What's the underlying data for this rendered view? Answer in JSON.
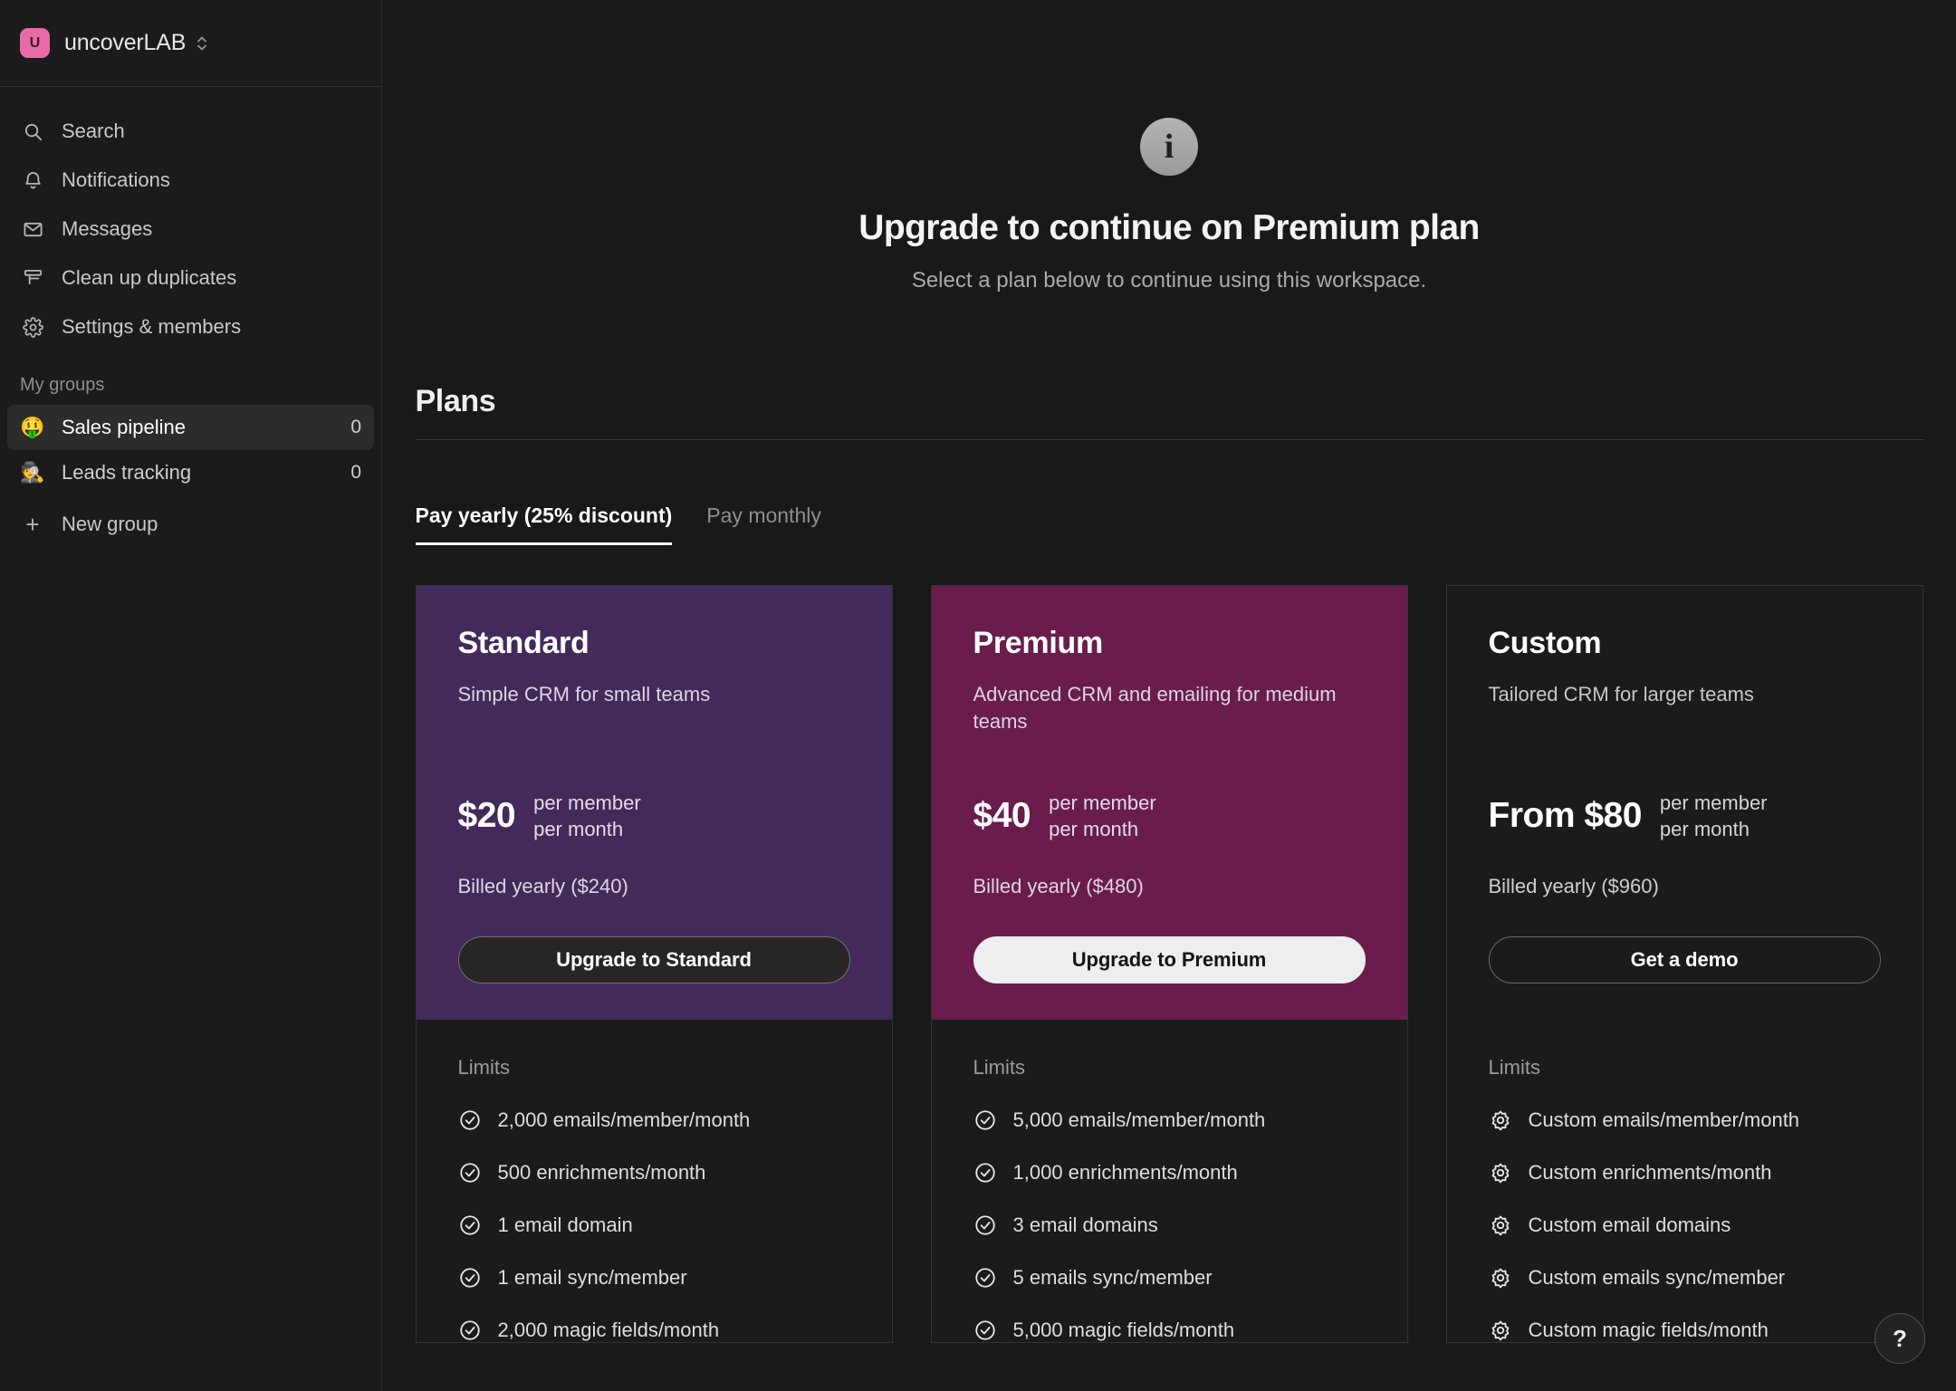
{
  "sidebar": {
    "workspace": {
      "initial": "U",
      "name": "uncoverLAB",
      "logo_color": "#e86aa6"
    },
    "nav": [
      {
        "icon": "search-icon",
        "label": "Search"
      },
      {
        "icon": "bell-icon",
        "label": "Notifications"
      },
      {
        "icon": "envelope-icon",
        "label": "Messages"
      },
      {
        "icon": "merge-icon",
        "label": "Clean up duplicates"
      },
      {
        "icon": "gear-icon",
        "label": "Settings & members"
      }
    ],
    "groups_title": "My groups",
    "groups": [
      {
        "emoji": "🤑",
        "label": "Sales pipeline",
        "count": "0",
        "active": true
      },
      {
        "emoji": "🕵️",
        "label": "Leads tracking",
        "count": "0",
        "active": false
      }
    ],
    "new_group_label": "New group"
  },
  "hero": {
    "icon": "info-icon",
    "badge_letter": "i",
    "title": "Upgrade to continue on Premium plan",
    "subtitle": "Select a plan below to continue using this workspace."
  },
  "plans": {
    "section_title": "Plans",
    "tabs": [
      {
        "label": "Pay yearly (25% discount)",
        "active": true
      },
      {
        "label": "Pay monthly",
        "active": false
      }
    ],
    "limits_label": "Limits",
    "cards": [
      {
        "id": "standard",
        "name": "Standard",
        "description": "Simple CRM for small teams",
        "price": "$20",
        "unit_line1": "per member",
        "unit_line2": "per month",
        "billed": "Billed yearly ($240)",
        "cta_label": "Upgrade to Standard",
        "cta_style": "dark",
        "head_color": "#432a5a",
        "limit_icon": "check-circle-icon",
        "limits": [
          "2,000 emails/member/month",
          "500 enrichments/month",
          "1 email domain",
          "1 email sync/member",
          "2,000 magic fields/month"
        ]
      },
      {
        "id": "premium",
        "name": "Premium",
        "description": "Advanced CRM and emailing for medium teams",
        "price": "$40",
        "unit_line1": "per member",
        "unit_line2": "per month",
        "billed": "Billed yearly ($480)",
        "cta_label": "Upgrade to Premium",
        "cta_style": "light",
        "head_color": "#6a1d4d",
        "limit_icon": "check-circle-icon",
        "limits": [
          "5,000 emails/member/month",
          "1,000 enrichments/month",
          "3 email domains",
          "5 emails sync/member",
          "5,000 magic fields/month"
        ]
      },
      {
        "id": "custom",
        "name": "Custom",
        "description": "Tailored CRM for larger teams",
        "price": "From $80",
        "unit_line1": "per member",
        "unit_line2": "per month",
        "billed": "Billed yearly ($960)",
        "cta_label": "Get a demo",
        "cta_style": "outline",
        "head_color": "#1b1b1b",
        "limit_icon": "gear-icon",
        "limits": [
          "Custom emails/member/month",
          "Custom enrichments/month",
          "Custom email domains",
          "Custom emails sync/member",
          "Custom magic fields/month"
        ]
      }
    ]
  },
  "help": {
    "label": "?"
  }
}
